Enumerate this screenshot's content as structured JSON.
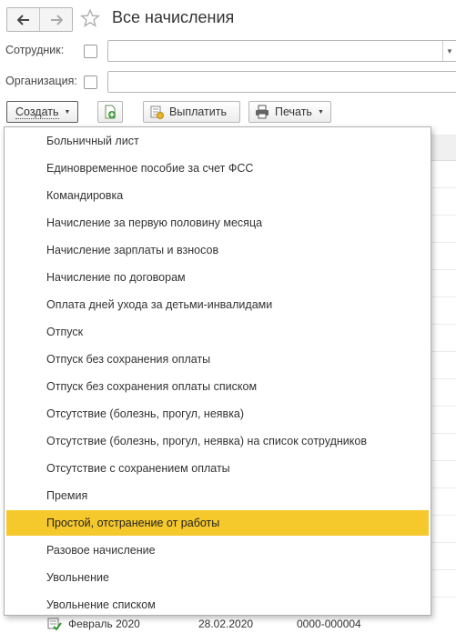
{
  "header": {
    "title": "Все начисления"
  },
  "filters": {
    "employee_label": "Сотрудник:",
    "organization_label": "Организация:",
    "employee_value": "",
    "organization_value": ""
  },
  "toolbar": {
    "create_label": "Создать",
    "pay_label": "Выплатить",
    "print_label": "Печать"
  },
  "menu": {
    "items": [
      "Больничный лист",
      "Единовременное пособие за счет ФСС",
      "Командировка",
      "Начисление за первую половину месяца",
      "Начисление зарплаты и взносов",
      "Начисление по договорам",
      "Оплата дней ухода за детьми-инвалидами",
      "Отпуск",
      "Отпуск без сохранения оплаты",
      "Отпуск без сохранения оплаты списком",
      "Отсутствие (болезнь, прогул, неявка)",
      "Отсутствие (болезнь, прогул, неявка) на список сотрудников",
      "Отсутствие с сохранением оплаты",
      "Премия",
      "Простой, отстранение от работы",
      "Разовое начисление",
      "Увольнение",
      "Увольнение списком"
    ],
    "highlighted": "Простой, отстранение от работы"
  },
  "table": {
    "visible_row": {
      "month": "Февраль 2020",
      "date": "28.02.2020",
      "number": "0000-000004"
    }
  },
  "colors": {
    "highlight": "#f5c82b",
    "border": "#b5b5b5"
  }
}
